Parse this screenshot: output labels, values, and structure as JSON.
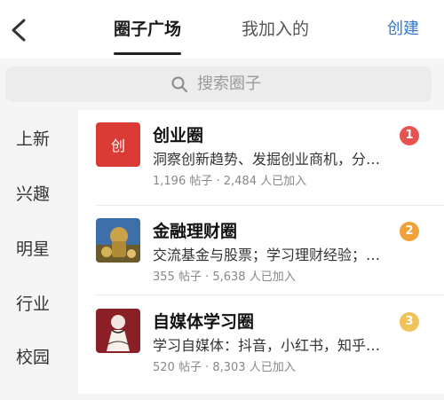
{
  "header": {
    "tabs": [
      {
        "label": "圈子广场",
        "active": true
      },
      {
        "label": "我加入的",
        "active": false
      }
    ],
    "create_label": "创建"
  },
  "search": {
    "placeholder": "搜索圈子"
  },
  "sidebar": {
    "items": [
      {
        "label": "上新"
      },
      {
        "label": "兴趣"
      },
      {
        "label": "明星"
      },
      {
        "label": "行业"
      },
      {
        "label": "校园"
      }
    ]
  },
  "circles": [
    {
      "name": "创业圈",
      "thumb_text": "创",
      "desc": "洞察创新趋势、发掘创业商机，分…",
      "stats": "1,196 帖子 · 2,484 人已加入",
      "rank": "1",
      "badge_color": "#e9534f"
    },
    {
      "name": "金融理财圈",
      "desc": "交流基金与股票；学习理财经验；…",
      "stats": "355 帖子 · 5,638 人已加入",
      "rank": "2",
      "badge_color": "#f0a13a"
    },
    {
      "name": "自媒体学习圈",
      "desc": "学习自媒体：抖音，小红书，知乎…",
      "stats": "520 帖子 · 8,303 人已加入",
      "rank": "3",
      "badge_color": "#f1c15a"
    }
  ]
}
